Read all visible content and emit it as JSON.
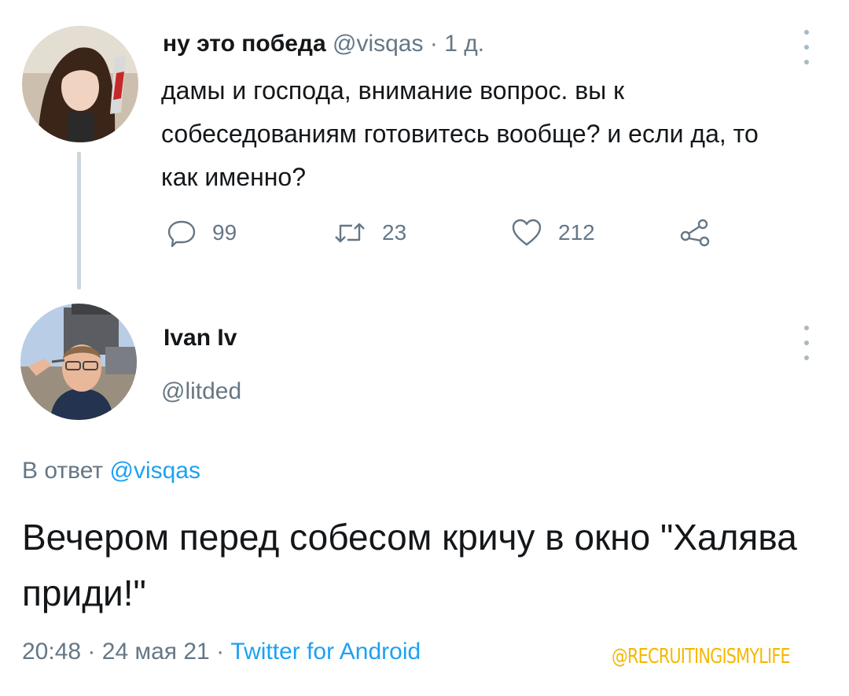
{
  "parent_tweet": {
    "display_name": "ну это победа",
    "handle": "@visqas",
    "separator": "·",
    "time_ago": "1 д.",
    "text": "дамы и господа, внимание вопрос. вы к собеседованиям готовитесь вообще? и если да, то как именно?",
    "actions": {
      "reply_count": "99",
      "retweet_count": "23",
      "like_count": "212"
    }
  },
  "reply_tweet": {
    "display_name": "Ivan Iv",
    "handle": "@litded",
    "reply_to_prefix": "В ответ",
    "reply_to_handle": "@visqas",
    "text": "Вечером перед собесом кричу в окно \"Халява приди!\"",
    "time": "20:48",
    "separator": "·",
    "date": "24 мая 21",
    "separator2": "·",
    "source": "Twitter for Android"
  },
  "watermark": "@RECRUITINGISMYLIFE",
  "colors": {
    "link": "#1da1f2",
    "muted": "#657786",
    "text": "#14171a",
    "thread_line": "#ccd6dd",
    "watermark": "#f5b800"
  },
  "icons": {
    "reply": "speech-bubble-icon",
    "retweet": "retweet-arrows-icon",
    "like": "heart-icon",
    "share": "share-nodes-icon",
    "more": "vertical-ellipsis-icon"
  }
}
